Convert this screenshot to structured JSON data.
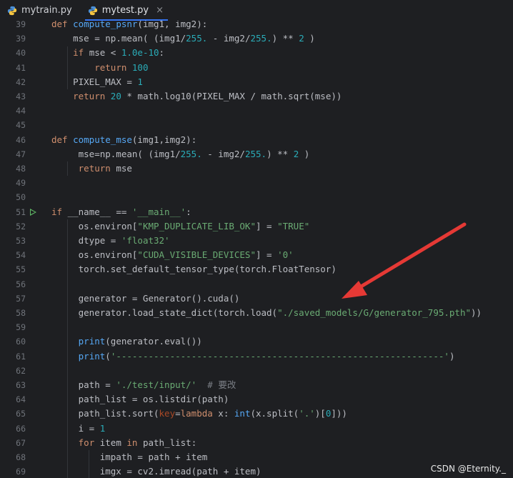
{
  "tabs": [
    {
      "label": "mytrain.py",
      "active": false
    },
    {
      "label": "mytest.py",
      "active": true,
      "close": "×"
    }
  ],
  "lines": [
    {
      "num": "39",
      "html": "<span class=\"kw\">def</span> <span class=\"fn\">compute_psnr</span>(img1, img2):"
    },
    {
      "num": "39",
      "html": "    mse = np.mean( (img1/<span class=\"num\">255.</span> - img2/<span class=\"num\">255.</span>) ** <span class=\"num\">2</span> )"
    },
    {
      "num": "40",
      "html": "    <span class=\"kw\">if</span> mse &lt; <span class=\"num\">1.0e-10</span>:"
    },
    {
      "num": "41",
      "html": "        <span class=\"kw\">return</span> <span class=\"num\">100</span>"
    },
    {
      "num": "42",
      "html": "    PIXEL_MAX = <span class=\"num\">1</span>"
    },
    {
      "num": "43",
      "html": "    <span class=\"kw\">return</span> <span class=\"num\">20</span> * math.log10(PIXEL_MAX / math.sqrt(mse))"
    },
    {
      "num": "44",
      "html": ""
    },
    {
      "num": "45",
      "html": ""
    },
    {
      "num": "46",
      "html": "<span class=\"kw\">def</span> <span class=\"fn\">compute_mse</span>(img1,img2):"
    },
    {
      "num": "47",
      "html": "     mse=np.mean( (img1/<span class=\"num\">255.</span> - img2/<span class=\"num\">255.</span>) ** <span class=\"num\">2</span> )"
    },
    {
      "num": "48",
      "html": "     <span class=\"kw\">return</span> mse"
    },
    {
      "num": "49",
      "html": ""
    },
    {
      "num": "50",
      "html": ""
    },
    {
      "num": "51",
      "html": "<span class=\"kw\">if</span> __name__ == <span class=\"str\">'__main__'</span>:"
    },
    {
      "num": "52",
      "html": "     os.environ[<span class=\"str\">\"KMP_DUPLICATE_LIB_OK\"</span>] = <span class=\"str\">\"TRUE\"</span>"
    },
    {
      "num": "53",
      "html": "     dtype = <span class=\"str\">'float32'</span>"
    },
    {
      "num": "54",
      "html": "     os.environ[<span class=\"str\">\"CUDA_VISIBLE_DEVICES\"</span>] = <span class=\"str\">'0'</span>"
    },
    {
      "num": "55",
      "html": "     torch.set_default_tensor_type(torch.FloatTensor)"
    },
    {
      "num": "56",
      "html": ""
    },
    {
      "num": "57",
      "html": "     generator = Generator().cuda()"
    },
    {
      "num": "58",
      "html": "     generator.load_state_dict(torch.load(<span class=\"str\">\"./saved_models/G/generator_795.pth\"</span>))"
    },
    {
      "num": "59",
      "html": ""
    },
    {
      "num": "60",
      "html": "     <span class=\"fn\">print</span>(generator.eval())"
    },
    {
      "num": "61",
      "html": "     <span class=\"fn\">print</span>(<span class=\"str\">'-------------------------------------------------------------'</span>)"
    },
    {
      "num": "62",
      "html": ""
    },
    {
      "num": "63",
      "html": "     path = <span class=\"str\">'./test/input/'</span>  <span class=\"cmt\"># 要改</span>"
    },
    {
      "num": "64",
      "html": "     path_list = os.listdir(path)"
    },
    {
      "num": "65",
      "html": "     path_list.sort(<span class=\"param\">key</span>=<span class=\"kw\">lambda</span> x: <span class=\"fn\">int</span>(x.split(<span class=\"str\">'.'</span>)[<span class=\"num\">0</span>]))"
    },
    {
      "num": "66",
      "html": "     i = <span class=\"num\">1</span>"
    },
    {
      "num": "67",
      "html": "     <span class=\"kw\">for</span> item <span class=\"kw\">in</span> path_list:"
    },
    {
      "num": "68",
      "html": "         impath = path + item"
    },
    {
      "num": "69",
      "html": "         imgx = cv2.imread(path + item)"
    }
  ],
  "colors": {
    "background": "#1e1f22",
    "keyword": "#cf8e6d",
    "function": "#56a8f5",
    "number": "#2aacb8",
    "string": "#6aab73",
    "arrow": "#e53935"
  },
  "watermark": "CSDN @Eternity._"
}
